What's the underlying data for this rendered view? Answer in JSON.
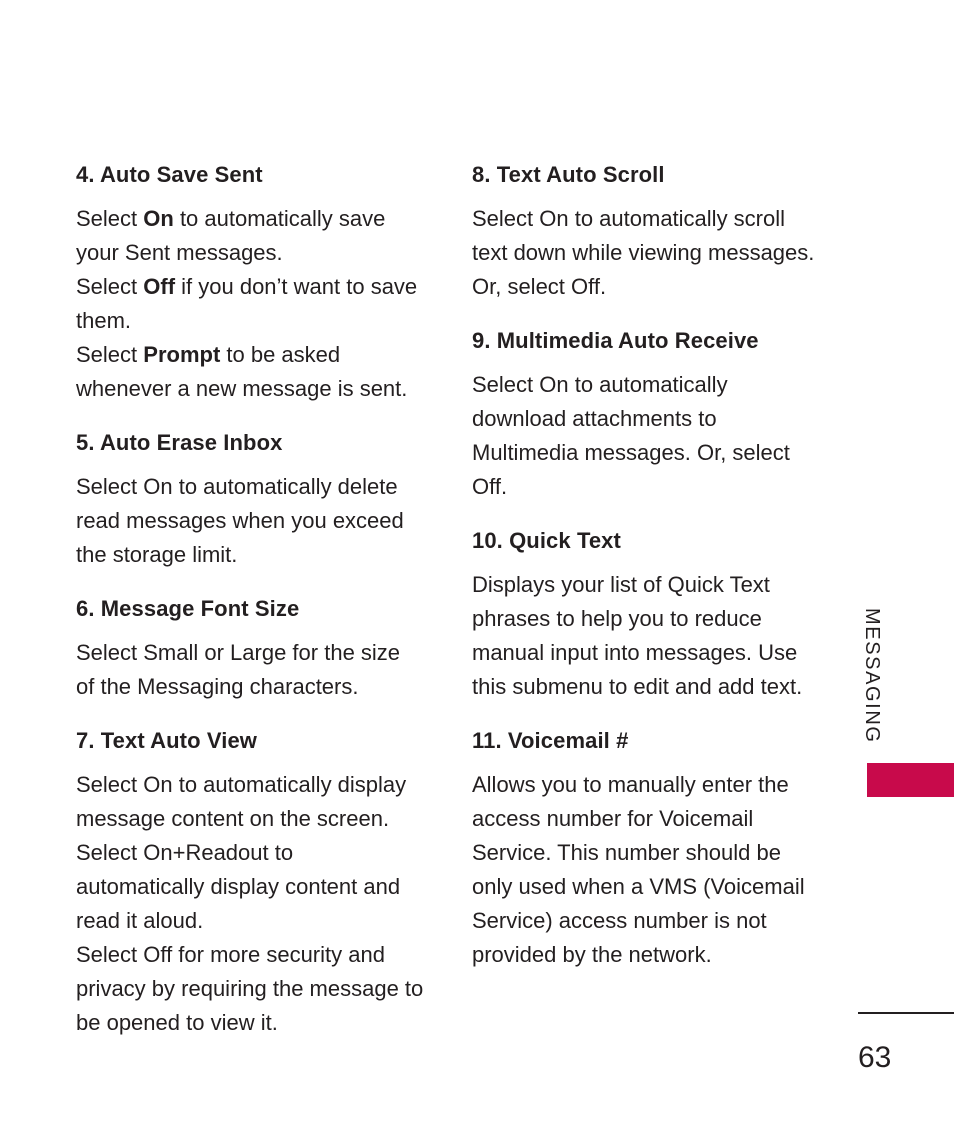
{
  "page": {
    "number": "63",
    "chapter_label": "MESSAGING",
    "tab_color": "#c80a4b",
    "text_color": "#231f20",
    "background_color": "#ffffff"
  },
  "columns": {
    "left": [
      {
        "heading": "4. Auto Save Sent",
        "body_html": "Select <b>On</b> to automatically save your Sent messages.<br>Select <b>Off</b> if you don’t want to save them.<br>Select <b>Prompt</b> to be asked whenever a new message is sent.",
        "body_text": "Select On to automatically save your Sent messages. Select Off if you don’t want to save them. Select Prompt to be asked whenever a new message is sent."
      },
      {
        "heading": "5. Auto Erase Inbox",
        "body_html": "Select On to automatically delete read messages when you exceed the storage limit.",
        "body_text": "Select On to automatically delete read messages when you exceed the storage limit."
      },
      {
        "heading": "6. Message Font Size",
        "body_html": "Select Small or Large for the size of the Messaging characters.",
        "body_text": "Select Small or Large for the size of the Messaging characters."
      },
      {
        "heading": "7. Text Auto View",
        "body_html": "Select On to automatically display message content on the screen. Select On+Readout to automatically display content and read it aloud.<br>Select Off for more security and privacy by requiring the message to be opened to view it.",
        "body_text": "Select On to automatically display message content on the screen. Select On+Readout to automatically display content and read it aloud. Select Off for more security and privacy by requiring the message to be opened to view it."
      }
    ],
    "right": [
      {
        "heading": "8. Text Auto Scroll",
        "body_html": "Select On to automatically scroll text down while viewing messages. Or, select Off.",
        "body_text": "Select On to automatically scroll text down while viewing messages. Or, select Off."
      },
      {
        "heading": "9. Multimedia Auto Receive",
        "body_html": "Select On to automatically download attachments to Multimedia messages. Or, select Off.",
        "body_text": "Select On to automatically download attachments to Multimedia messages. Or, select Off."
      },
      {
        "heading": "10. Quick Text",
        "body_html": "Displays your list of Quick Text phrases to help you to reduce manual input into messages. Use this submenu to edit and add text.",
        "body_text": "Displays your list of Quick Text phrases to help you to reduce manual input into messages. Use this submenu to edit and add text."
      },
      {
        "heading": "11. Voicemail #",
        "body_html": "Allows you to manually enter the access number for Voicemail Service. This number should be only used when a VMS (Voicemail Service) access number is not provided by the network.",
        "body_text": "Allows you to manually enter the access number for Voicemail Service. This number should be only used when a VMS (Voicemail Service) access number is not provided by the network."
      }
    ]
  }
}
